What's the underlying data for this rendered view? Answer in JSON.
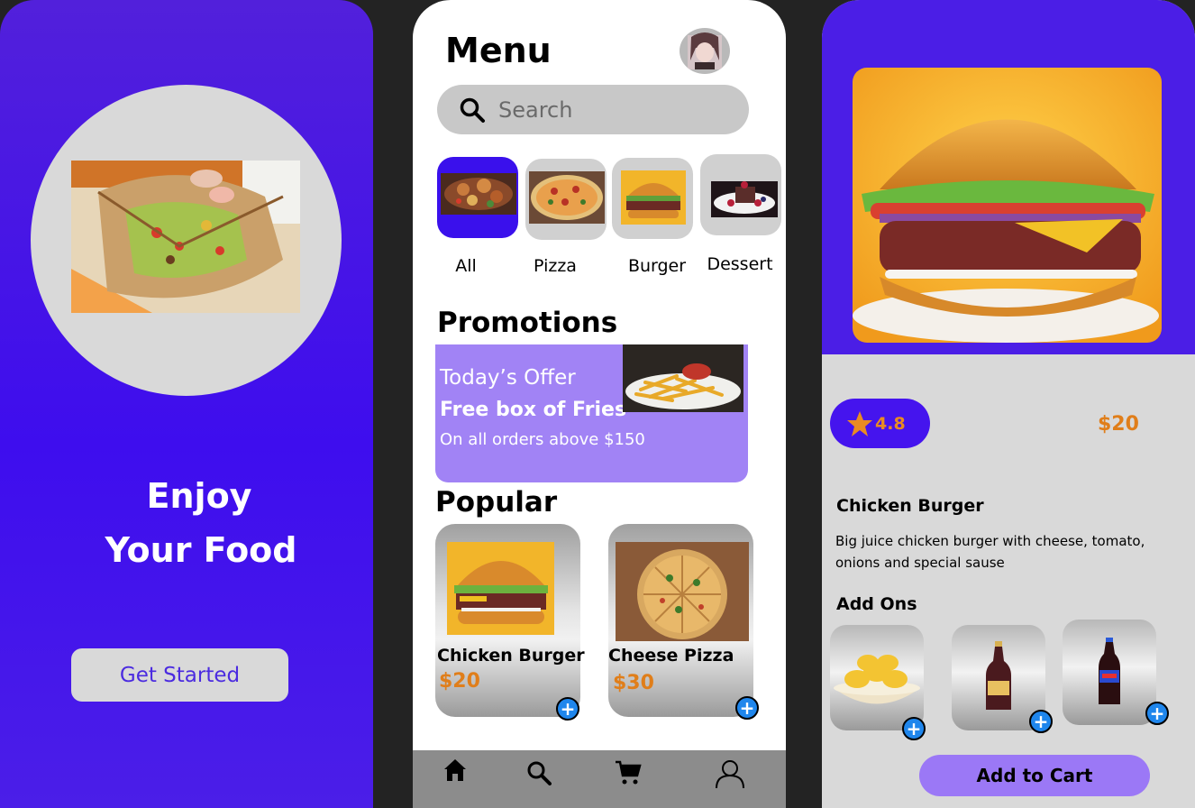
{
  "welcome": {
    "headline_line1": "Enjoy",
    "headline_line2": "Your Food",
    "cta_label": "Get Started"
  },
  "menu": {
    "title": "Menu",
    "search_placeholder": "Search",
    "categories": [
      {
        "label": "All",
        "active": true
      },
      {
        "label": "Pizza",
        "active": false
      },
      {
        "label": "Burger",
        "active": false
      },
      {
        "label": "Dessert",
        "active": false
      }
    ],
    "promotions_title": "Promotions",
    "promo": {
      "line1": "Today’s Offer",
      "line2": "Free box of Fries",
      "line3": "On all orders above $150"
    },
    "popular_title": "Popular",
    "popular": [
      {
        "name": "Chicken Burger",
        "price": "$20"
      },
      {
        "name": "Cheese Pizza",
        "price": "$30"
      }
    ],
    "nav": [
      "home-icon",
      "search-icon",
      "cart-icon",
      "profile-icon"
    ]
  },
  "detail": {
    "rating": "4.8",
    "price": "$20",
    "name": "Chicken Burger",
    "description": "Big juice chicken burger with cheese, tomato, onions and special sause",
    "addons_title": "Add Ons",
    "add_to_cart_label": "Add to Cart"
  },
  "colors": {
    "primary_purple": "#4b1ee6",
    "accent_orange": "#e07e1a",
    "promo_lilac": "#a183f5",
    "plus_blue": "#1f86ec"
  }
}
